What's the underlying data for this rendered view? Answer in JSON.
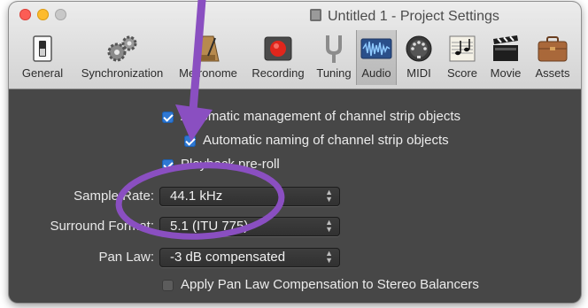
{
  "window": {
    "title": "Untitled 1 - Project Settings"
  },
  "toolbar": {
    "items": [
      {
        "label": "General",
        "icon": "switch-icon"
      },
      {
        "label": "Synchronization",
        "icon": "gears-icon"
      },
      {
        "label": "Metronome",
        "icon": "metronome-icon"
      },
      {
        "label": "Recording",
        "icon": "record-icon"
      },
      {
        "label": "Tuning",
        "icon": "tuning-fork-icon"
      },
      {
        "label": "Audio",
        "icon": "waveform-icon",
        "active": true
      },
      {
        "label": "MIDI",
        "icon": "midi-port-icon"
      },
      {
        "label": "Score",
        "icon": "score-icon"
      },
      {
        "label": "Movie",
        "icon": "clapperboard-icon"
      },
      {
        "label": "Assets",
        "icon": "briefcase-icon"
      }
    ]
  },
  "audio": {
    "auto_management": {
      "label": "Automatic management of channel strip objects",
      "checked": true
    },
    "auto_naming": {
      "label": "Automatic naming of channel strip objects",
      "checked": true
    },
    "playback_preroll": {
      "label": "Playback pre-roll",
      "checked": true
    },
    "sample_rate": {
      "label": "Sample Rate:",
      "value": "44.1 kHz"
    },
    "surround_format": {
      "label": "Surround Format:",
      "value": "5.1 (ITU 775)"
    },
    "pan_law": {
      "label": "Pan Law:",
      "value": "-3 dB compensated"
    },
    "pan_law_comp": {
      "label": "Apply Pan Law Compensation to Stereo Balancers",
      "checked": false
    }
  },
  "annotation": {
    "color": "#8a4fc1"
  }
}
